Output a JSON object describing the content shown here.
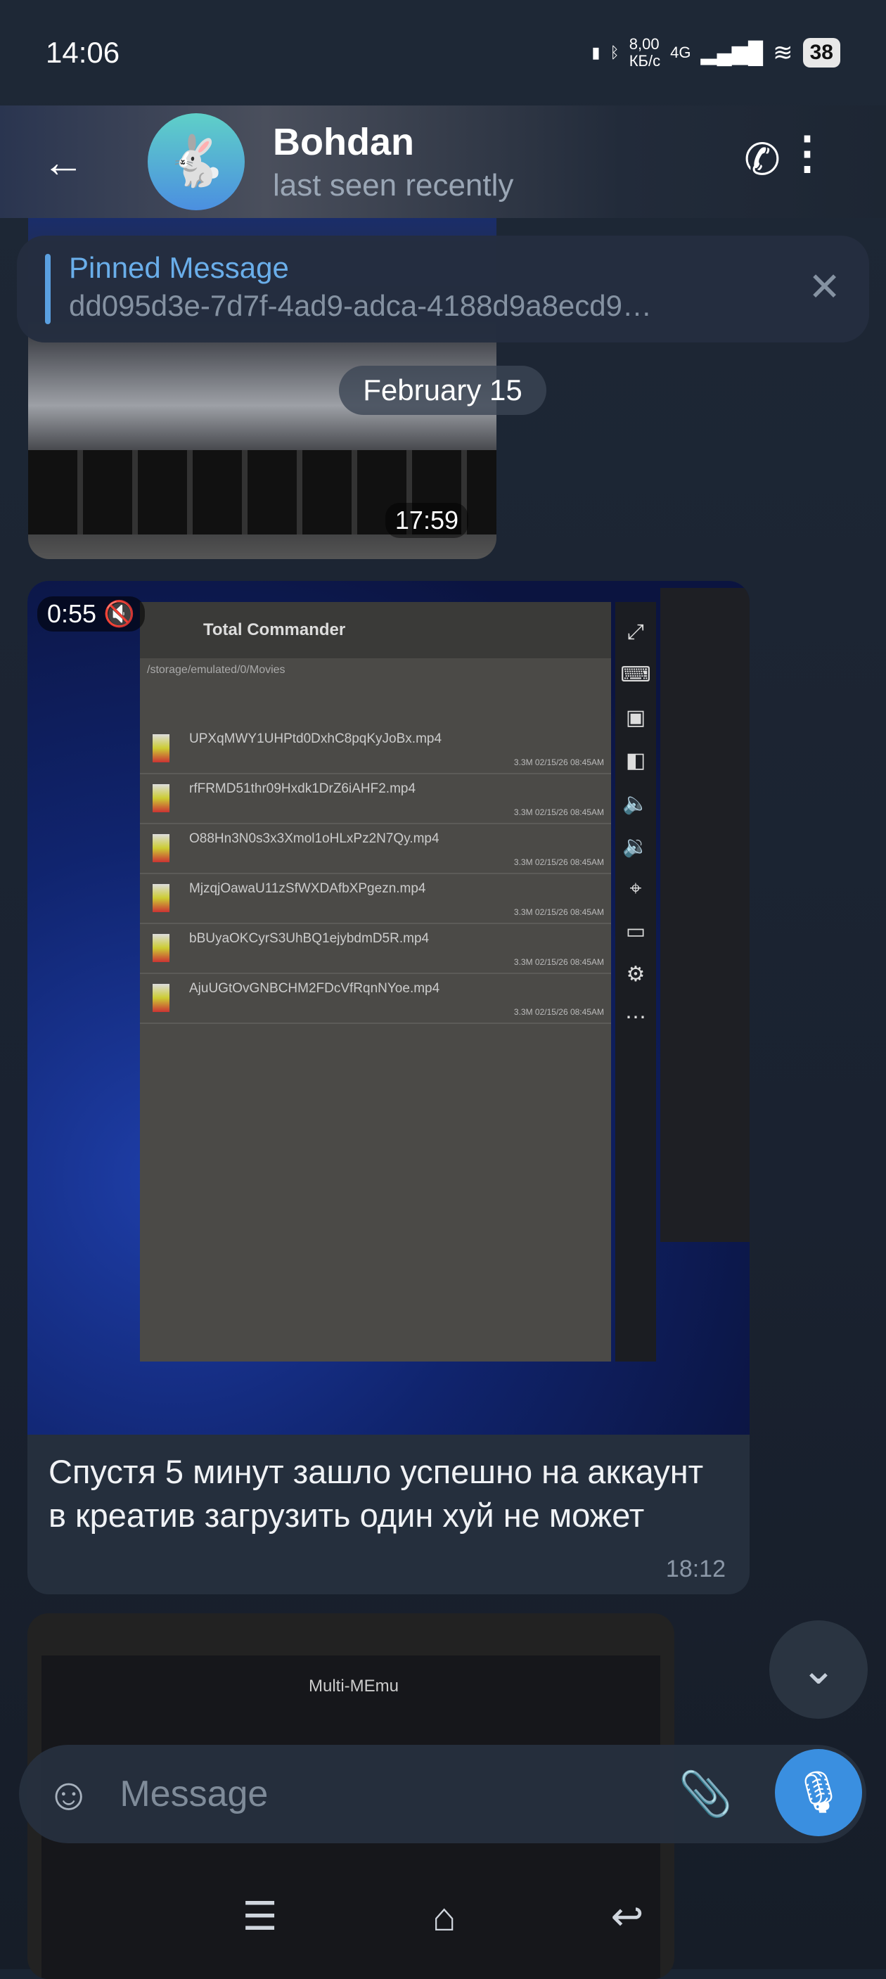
{
  "status_bar": {
    "time": "14:06",
    "net_speed": "8,00",
    "net_unit": "КБ/с",
    "network": "4G",
    "battery": "38"
  },
  "header": {
    "name": "Bohdan",
    "status": "last seen recently",
    "avatar_emoji": "🐇"
  },
  "pinned": {
    "title": "Pinned Message",
    "text": "dd095d3e-7d7f-4ad9-adca-4188d9a8ecd9…"
  },
  "date_chip": "February 15",
  "messages": [
    {
      "time": "17:59"
    },
    {
      "video_duration": "0:55",
      "video": {
        "app_title": "Total Commander",
        "path": "/storage/emulated/0/Movies",
        "files": [
          "UPXqMWY1UHPtd0DxhC8pqKyJoBx.mp4",
          "rfFRMD51thr09Hxdk1DrZ6iAHF2.mp4",
          "O88Hn3N0s3x3Xmol1oHLxPz2N7Qy.mp4",
          "MjzqjOawaU11zSfWXDAfbXPgezn.mp4",
          "bBUyaOKCyrS3UhBQ1ejybdmD5R.mp4",
          "AjuUGtOvGNBCHM2FDcVfRqnNYoe.mp4"
        ],
        "file_meta": "3.3M 02/15/26 08:45AM"
      },
      "text": "Спустя 5 минут зашло успешно на аккаунт в креатив загрузить один хуй не может",
      "time": "18:12"
    },
    {
      "preview_title": "Multi-MEmu"
    }
  ],
  "input": {
    "placeholder": "Message"
  }
}
